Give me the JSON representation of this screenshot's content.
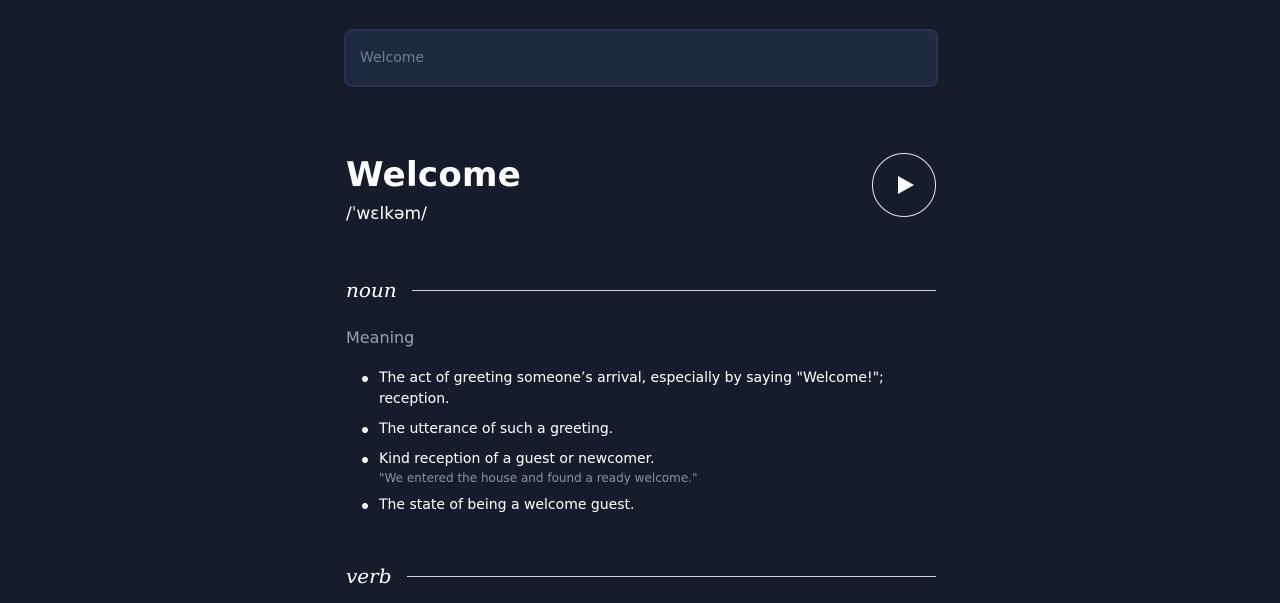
{
  "search": {
    "placeholder": "Welcome",
    "value": ""
  },
  "word": {
    "title": "Welcome",
    "phonetic": "/ˈwɛlkəm/"
  },
  "audio": {
    "icon": "play-icon"
  },
  "meanings": [
    {
      "part_of_speech": "noun",
      "heading": "Meaning",
      "definitions": [
        {
          "text": "The act of greeting someone’s arrival, especially by saying \"Welcome!\"; reception.",
          "example": ""
        },
        {
          "text": "The utterance of such a greeting.",
          "example": ""
        },
        {
          "text": "Kind reception of a guest or newcomer.",
          "example": "\"We entered the house and found a ready welcome.\""
        },
        {
          "text": "The state of being a welcome guest.",
          "example": ""
        }
      ]
    },
    {
      "part_of_speech": "verb"
    }
  ],
  "colors": {
    "background": "#161c2c",
    "input_background": "#1f2942",
    "text": "#ffffff",
    "muted_text": "#9aa0ad"
  }
}
